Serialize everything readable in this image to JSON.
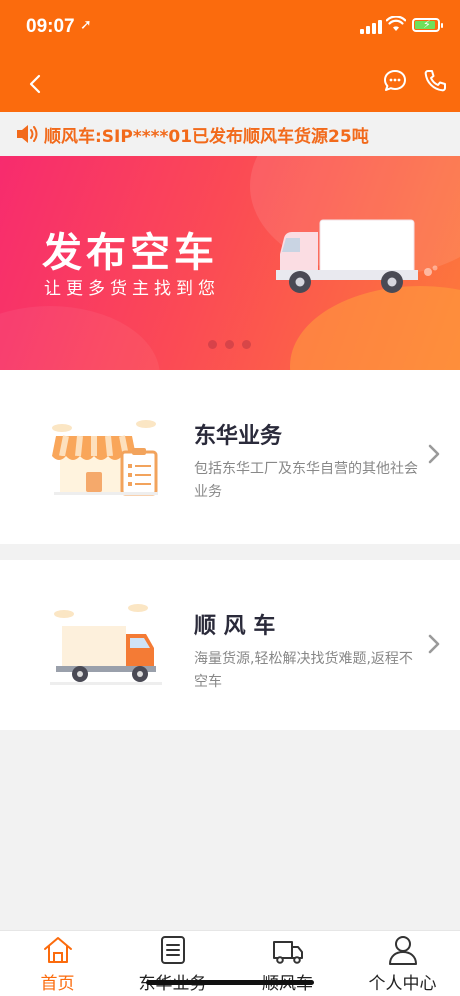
{
  "status_bar": {
    "time": "09:07",
    "location_icon": "location-arrow-icon"
  },
  "navbar": {
    "back_icon": "back-chevron-icon",
    "chat_icon": "chat-bubble-icon",
    "phone_icon": "phone-icon"
  },
  "notice": {
    "icon": "speaker-icon",
    "text": "顺风车:SIP****01已发布顺风车货源25吨"
  },
  "banner": {
    "title": "发布空车",
    "subtitle": "让更多货主找到您",
    "page_count": 3,
    "active_page": 1
  },
  "services": [
    {
      "name": "东华业务",
      "description": "包括东华工厂及东华自营的其他社会业务",
      "icon": "storefront-icon"
    },
    {
      "name": "顺 风 车",
      "description": "海量货源,轻松解决找货难题,返程不空车",
      "icon": "truck-icon"
    }
  ],
  "tabs": [
    {
      "label": "首页",
      "icon": "home-icon",
      "active": true
    },
    {
      "label": "东华业务",
      "icon": "document-icon",
      "active": false
    },
    {
      "label": "顺风车",
      "icon": "truck-icon",
      "active": false
    },
    {
      "label": "个人中心",
      "icon": "person-icon",
      "active": false
    }
  ],
  "colors": {
    "brand": "#fb6b0d",
    "notice_text": "#f26a1b",
    "banner_start": "#f72b6e",
    "banner_end": "#fd7a3a"
  }
}
